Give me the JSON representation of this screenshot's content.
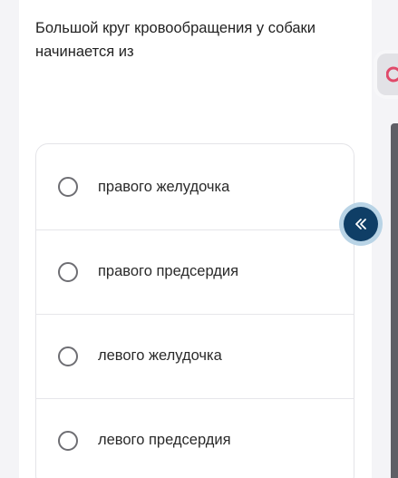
{
  "question": {
    "text": "Большой круг кровообращения у собаки начинается из"
  },
  "options": [
    {
      "label": "правого желудочка",
      "selected": false
    },
    {
      "label": "правого предсердия",
      "selected": false
    },
    {
      "label": "левого желудочка",
      "selected": false
    },
    {
      "label": "левого предсердия",
      "selected": false
    }
  ],
  "side_tab": {
    "icon": "c-shape-icon",
    "color": "#e04a6a"
  },
  "collapse_button": {
    "icon": "double-chevron-left-icon",
    "color": "#0f3e66"
  }
}
